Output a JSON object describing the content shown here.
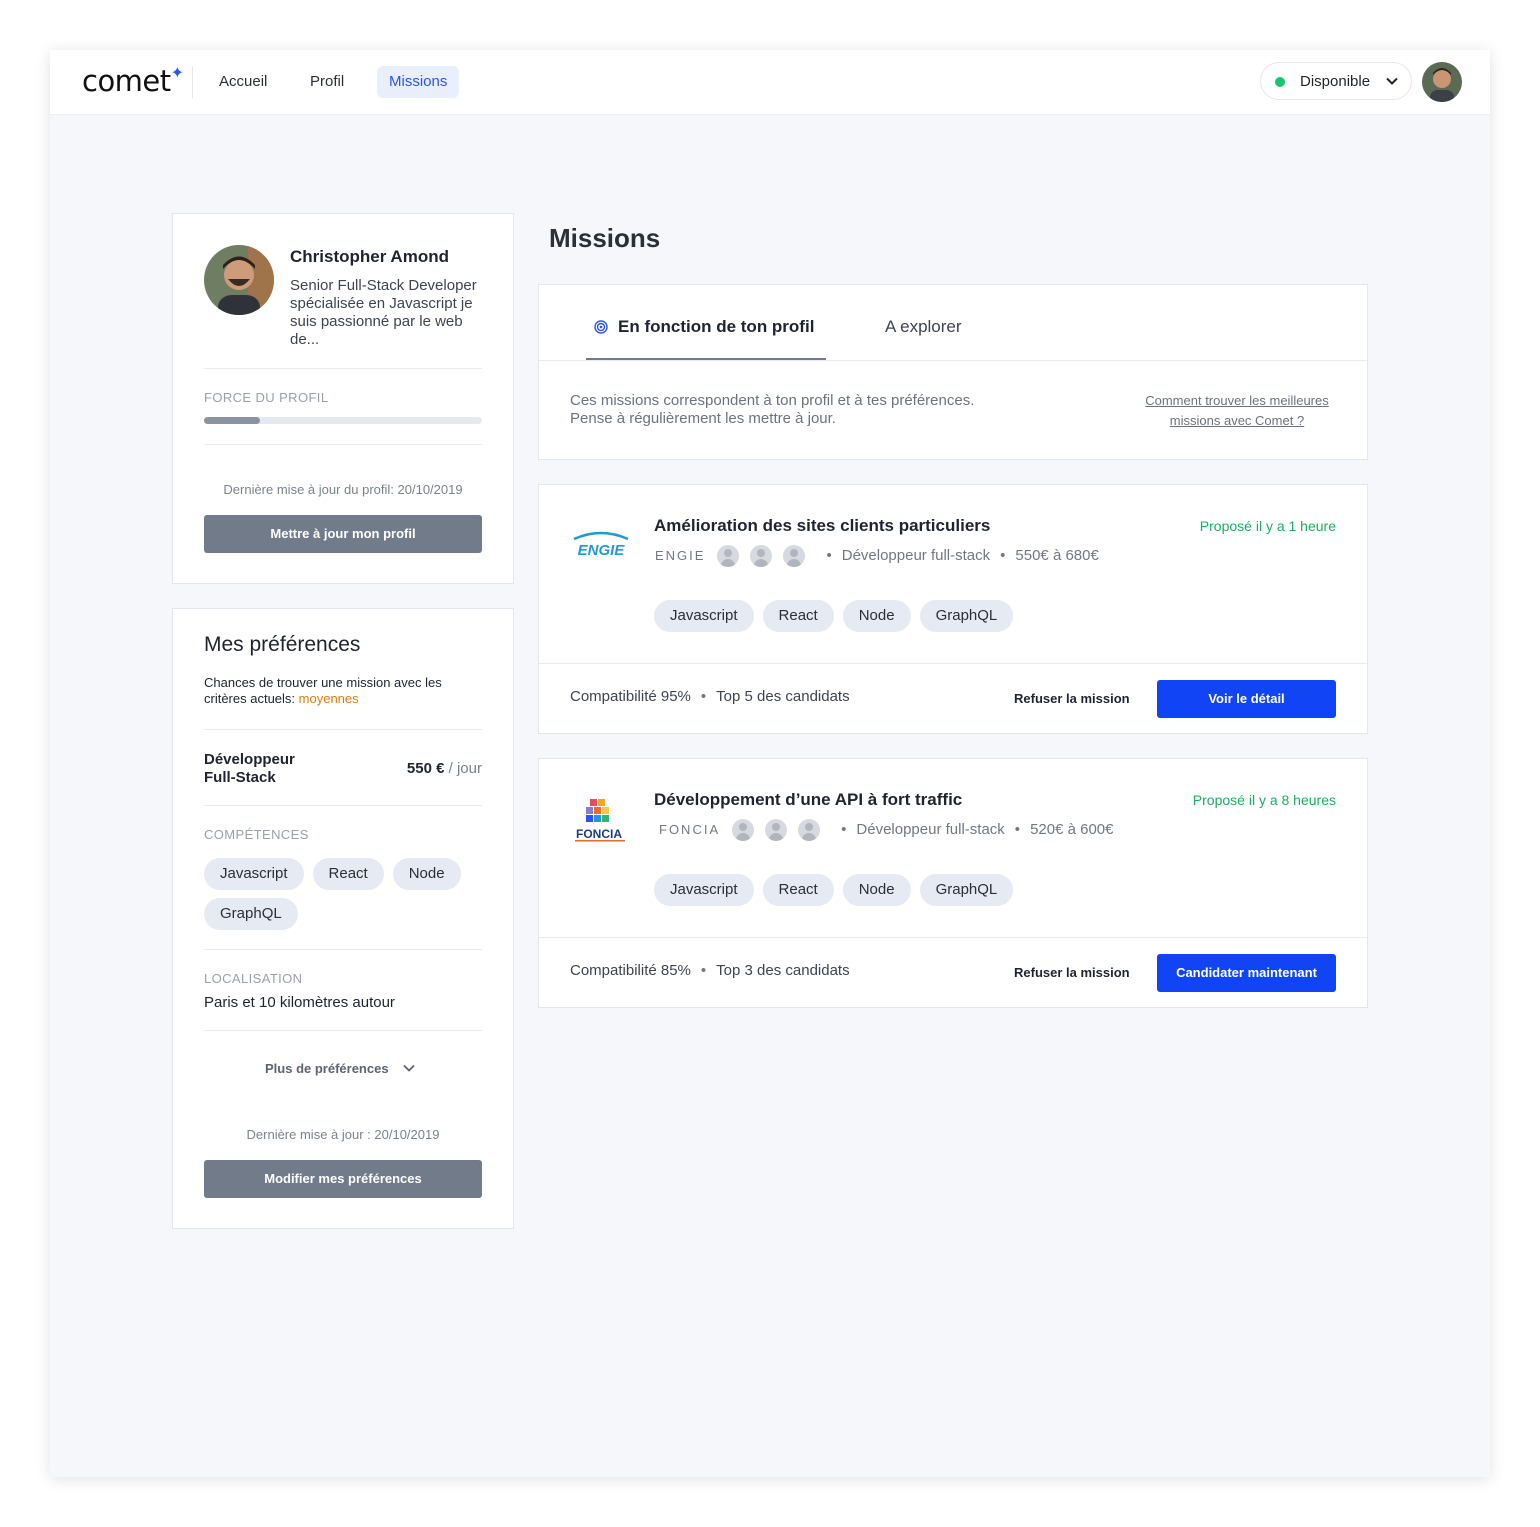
{
  "header": {
    "logo": "comet",
    "nav": [
      "Accueil",
      "Profil",
      "Missions"
    ],
    "active_nav": "Missions",
    "status_label": "Disponible",
    "status_color": "#1bc46a"
  },
  "profile_card": {
    "name": "Christopher Amond",
    "bio": "Senior Full-Stack Developer spécialisée en Javascript je suis passionné par le web de...",
    "strength_label": "FORCE DU PROFIL",
    "strength_fraction": 0.2,
    "last_update": "Dernière mise à jour du profil: 20/10/2019",
    "update_button": "Mettre à jour mon profil"
  },
  "preferences": {
    "title": "Mes préférences",
    "chances_text": "Chances de trouver une mission avec les critères actuels: ",
    "chances_value": "moyennes",
    "chances_color": "#e07b12",
    "role": "Développeur Full-Stack",
    "rate": "550 €",
    "rate_unit": "/ jour",
    "skills_label": "COMPÉTENCES",
    "skills": [
      "Javascript",
      "React",
      "Node",
      "GraphQL"
    ],
    "location_label": "LOCALISATION",
    "location_value": "Paris et 10 kilomètres autour",
    "more_label": "Plus de préférences",
    "last_update": "Dernière mise à jour : 20/10/2019",
    "edit_button": "Modifier mes préférences"
  },
  "missions": {
    "title": "Missions",
    "tabs": [
      "En fonction de ton profil",
      "A explorer"
    ],
    "active_tab": 0,
    "intro_line1": "Ces missions correspondent à ton profil et à tes préférences.",
    "intro_line2": "Pense à régulièrement les mettre à jour.",
    "help_link_line1": "Comment trouver les meilleures",
    "help_link_line2": "missions avec Comet ?",
    "cards": [
      {
        "logo_text": "ENGIE",
        "title": "Amélioration des sites clients particuliers",
        "company": "ENGIE",
        "role": "Développeur full-stack",
        "rate": "550€ à 680€",
        "proposed": "Proposé il y a 1 heure",
        "tags": [
          "Javascript",
          "React",
          "Node",
          "GraphQL"
        ],
        "compat": "Compatibilité 95%",
        "rank": "Top 5 des candidats",
        "refuse": "Refuser la mission",
        "cta": "Voir le détail"
      },
      {
        "logo_text": "FONCIA",
        "title": "Développement d’une API à fort traffic",
        "company": "FONCIA",
        "role": "Développeur full-stack",
        "rate": "520€ à 600€",
        "proposed": "Proposé il y a 8 heures",
        "tags": [
          "Javascript",
          "React",
          "Node",
          "GraphQL"
        ],
        "compat": "Compatibilité 85%",
        "rank": "Top 3 des candidats",
        "refuse": "Refuser la mission",
        "cta": "Candidater maintenant"
      }
    ]
  }
}
